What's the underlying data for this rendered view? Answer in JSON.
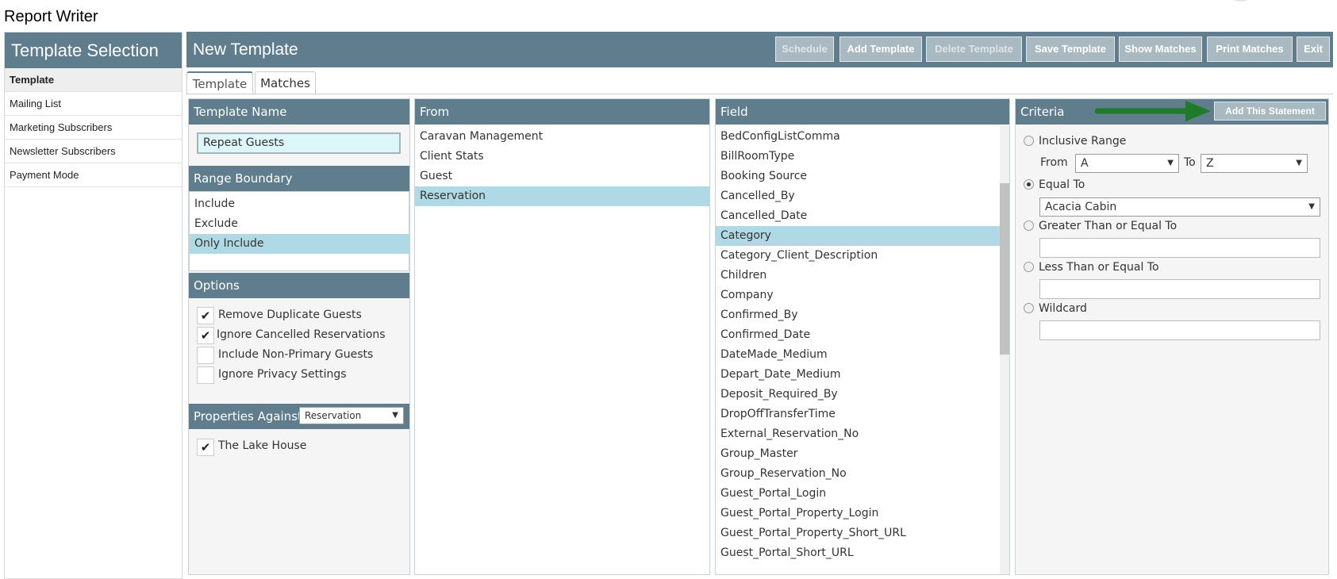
{
  "app": {
    "title": "Report Writer"
  },
  "sidebar": {
    "title": "Template Selection",
    "items": [
      {
        "label": "Template",
        "active": true
      },
      {
        "label": "Mailing List"
      },
      {
        "label": "Marketing Subscribers"
      },
      {
        "label": "Newsletter Subscribers"
      },
      {
        "label": "Payment Mode"
      }
    ]
  },
  "main": {
    "title": "New Template",
    "buttons": {
      "schedule": "Schedule",
      "add_template": "Add Template",
      "delete_template": "Delete Template",
      "save_template": "Save Template",
      "show_matches": "Show Matches",
      "print_matches": "Print Matches",
      "exit": "Exit"
    },
    "tabs": {
      "template": "Template",
      "matches": "Matches"
    }
  },
  "template_name": {
    "header": "Template Name",
    "value": "Repeat Guests"
  },
  "range_boundary": {
    "header": "Range Boundary",
    "items": [
      "Include",
      "Exclude",
      "Only Include"
    ],
    "selected": "Only Include"
  },
  "options": {
    "header": "Options",
    "items": [
      {
        "label": "Remove Duplicate Guests",
        "checked": true
      },
      {
        "label": "Ignore Cancelled Reservations",
        "checked": true
      },
      {
        "label": "Include Non-Primary Guests",
        "checked": false
      },
      {
        "label": "Ignore Privacy Settings",
        "checked": false
      }
    ]
  },
  "properties": {
    "header": "Properties Against",
    "select_value": "Reservation",
    "items": [
      {
        "label": "The Lake House",
        "checked": true
      }
    ]
  },
  "from": {
    "header": "From",
    "items": [
      "Caravan Management",
      "Client Stats",
      "Guest",
      "Reservation"
    ],
    "selected": "Reservation"
  },
  "field": {
    "header": "Field",
    "items": [
      "BedConfigListComma",
      "BillRoomType",
      "Booking Source",
      "Cancelled_By",
      "Cancelled_Date",
      "Category",
      "Category_Client_Description",
      "Children",
      "Company",
      "Confirmed_By",
      "Confirmed_Date",
      "DateMade_Medium",
      "Depart_Date_Medium",
      "Deposit_Required_By",
      "DropOffTransferTime",
      "External_Reservation_No",
      "Group_Master",
      "Group_Reservation_No",
      "Guest_Portal_Login",
      "Guest_Portal_Property_Login",
      "Guest_Portal_Property_Short_URL",
      "Guest_Portal_Short_URL"
    ],
    "selected": "Category"
  },
  "criteria": {
    "header": "Criteria",
    "add_button": "Add This Statement",
    "inclusive_range": {
      "label": "Inclusive Range",
      "from_label": "From",
      "from_value": "A",
      "to_label": "To",
      "to_value": "Z"
    },
    "equal_to": {
      "label": "Equal To",
      "value": "Acacia Cabin",
      "checked": true
    },
    "greater_than": {
      "label": "Greater Than or Equal To",
      "value": ""
    },
    "less_than": {
      "label": "Less Than or Equal To",
      "value": ""
    },
    "wildcard": {
      "label": "Wildcard",
      "value": ""
    }
  },
  "colors": {
    "header": "#5f7d8c",
    "selection": "#b0d9e6",
    "arrow": "#1f7a2a"
  }
}
